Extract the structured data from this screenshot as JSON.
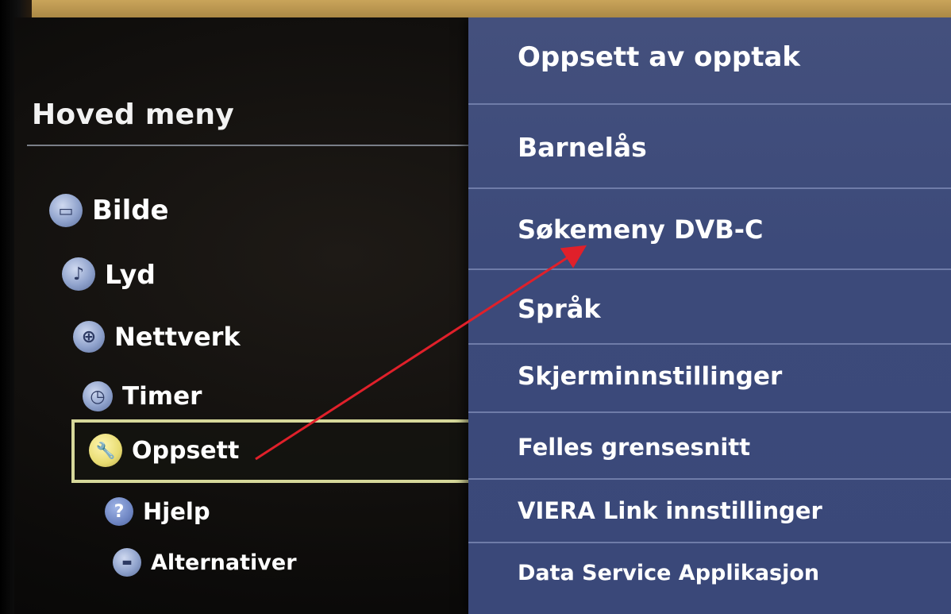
{
  "main_menu": {
    "title": "Hoved meny",
    "items": [
      {
        "label": "Bilde",
        "icon": "tv-icon",
        "glyph": "▭"
      },
      {
        "label": "Lyd",
        "icon": "music-note-icon",
        "glyph": "♪"
      },
      {
        "label": "Nettverk",
        "icon": "globe-icon",
        "glyph": "⊕"
      },
      {
        "label": "Timer",
        "icon": "clock-icon",
        "glyph": "◷"
      },
      {
        "label": "Oppsett",
        "icon": "wrench-icon",
        "glyph": "🔧",
        "selected": true
      },
      {
        "label": "Hjelp",
        "icon": "help-icon",
        "glyph": "?"
      },
      {
        "label": "Alternativer",
        "icon": "options-icon",
        "glyph": "▬"
      }
    ]
  },
  "submenu": {
    "items": [
      "Oppsett av opptak",
      "Barnelås",
      "Søkemeny DVB-C",
      "Språk",
      "Skjerminnstillinger",
      "Felles grensesnitt",
      "VIERA Link innstillinger",
      "Data Service Applikasjon"
    ]
  },
  "colors": {
    "submenu_bg": "#3c4a7a",
    "highlight_border": "#d6d89a",
    "annotation_arrow": "#e0202a"
  }
}
